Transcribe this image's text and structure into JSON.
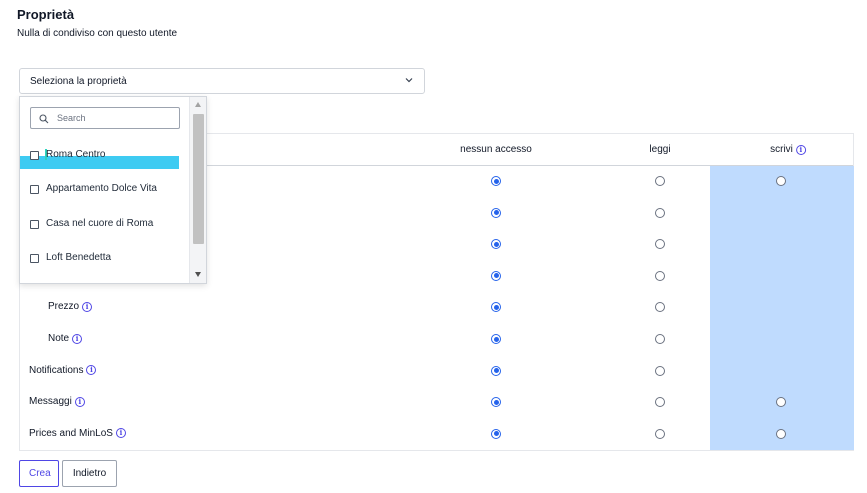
{
  "header": {
    "title": "Proprietà",
    "subtitle": "Nulla di condiviso con questo utente"
  },
  "property_select": {
    "label": "Seleziona la proprietà",
    "search_placeholder": "Search",
    "options": [
      {
        "label": "Roma Centro",
        "checked": false
      },
      {
        "label": "Appartamento Dolce Vita",
        "checked": false
      },
      {
        "label": "Casa nel cuore di Roma",
        "checked": false
      },
      {
        "label": "Loft Benedetta",
        "checked": false
      }
    ]
  },
  "table": {
    "columns": [
      {
        "label": "nessun accesso",
        "info": false
      },
      {
        "label": "leggi",
        "info": false
      },
      {
        "label": "scrivi",
        "info": true
      }
    ],
    "rows": [
      {
        "label": "",
        "indent": true,
        "info": false,
        "selected": "nessun accesso",
        "write_option": true
      },
      {
        "label": "",
        "indent": true,
        "info": false,
        "selected": "nessun accesso",
        "write_option": false
      },
      {
        "label": "",
        "indent": true,
        "info": false,
        "selected": "nessun accesso",
        "write_option": false
      },
      {
        "label": "",
        "indent": true,
        "info": false,
        "selected": "nessun accesso",
        "write_option": false
      },
      {
        "label": "Prezzo",
        "indent": true,
        "info": true,
        "selected": "nessun accesso",
        "write_option": false
      },
      {
        "label": "Note",
        "indent": true,
        "info": true,
        "selected": "nessun accesso",
        "write_option": false
      },
      {
        "label": "Notifications",
        "indent": false,
        "info": true,
        "selected": "nessun accesso",
        "write_option": false
      },
      {
        "label": "Messaggi",
        "indent": false,
        "info": true,
        "selected": "nessun accesso",
        "write_option": true
      },
      {
        "label": "Prices and MinLoS",
        "indent": false,
        "info": true,
        "selected": "nessun accesso",
        "write_option": true
      }
    ]
  },
  "actions": {
    "create_label": "Crea",
    "back_label": "Indietro"
  },
  "colors": {
    "accent": "#4f46e5",
    "radio_selected": "#2563eb",
    "write_column_bg": "#bfdbfe",
    "dropdown_highlight": "#3ecbf2"
  },
  "icons": {
    "info": "i",
    "chevron": "chevron-down-icon",
    "search": "search-icon"
  }
}
